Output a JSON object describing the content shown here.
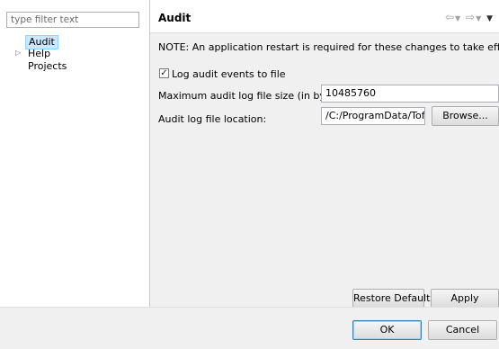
{
  "filter": {
    "placeholder": "type filter text"
  },
  "tree": {
    "items": [
      {
        "label": "Audit"
      },
      {
        "label": "Help"
      },
      {
        "label": "Projects"
      }
    ]
  },
  "page": {
    "title": "Audit",
    "note": "NOTE: An application restart is required for these changes to take effect.",
    "log_checkbox_label": "Log audit events to file",
    "log_checked": true,
    "max_size_label": "Maximum audit log file size (in bytes):",
    "max_size_value": "10485760",
    "location_label": "Audit log file location:",
    "location_value": "/C:/ProgramData/Tofi",
    "browse_label": "Browse...",
    "restore_label": "Restore Defaults",
    "apply_label": "Apply"
  },
  "dialog": {
    "ok_label": "OK",
    "cancel_label": "Cancel"
  },
  "icons": {
    "back": "back-arrow-icon",
    "back_menu": "dropdown-icon",
    "forward": "forward-arrow-icon",
    "forward_menu": "dropdown-icon",
    "view_menu": "view-menu-icon"
  }
}
